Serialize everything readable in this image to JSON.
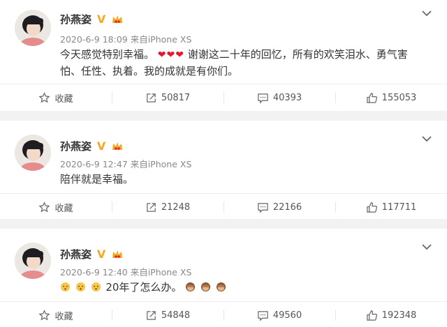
{
  "posts": [
    {
      "author": "孙燕姿",
      "verified_badge": "V",
      "meta": "2020-6-9 18:09 来自iPhone XS",
      "text_1": "今天感觉特别幸福。",
      "hearts": "❤❤❤",
      "text_2": "谢谢这二十年的回忆，所有的欢笑泪水、勇气害",
      "text_3": "怕、任性、执着。我的成就是有你们。",
      "actions": {
        "favorite": "收藏",
        "repost": "50817",
        "comment": "40393",
        "like": "155053"
      }
    },
    {
      "author": "孙燕姿",
      "verified_badge": "V",
      "meta": "2020-6-9 12:47 来自iPhone XS",
      "text_1": "陪伴就是幸福。",
      "actions": {
        "favorite": "收藏",
        "repost": "21248",
        "comment": "22166",
        "like": "117711"
      }
    },
    {
      "author": "孙燕姿",
      "verified_badge": "V",
      "meta": "2020-6-9 12:40 来自iPhone XS",
      "text_1": "20年了怎么办。",
      "actions": {
        "favorite": "收藏",
        "repost": "54848",
        "comment": "49560",
        "like": "192348"
      }
    }
  ],
  "colors": {
    "accent_badge": "#f5a623",
    "heart": "#e6162d",
    "divider": "#eeeeee",
    "meta_text": "#888888"
  },
  "icons": [
    "star-icon",
    "repost-icon",
    "comment-icon",
    "like-icon",
    "chevron-down-icon",
    "crown-icon"
  ]
}
